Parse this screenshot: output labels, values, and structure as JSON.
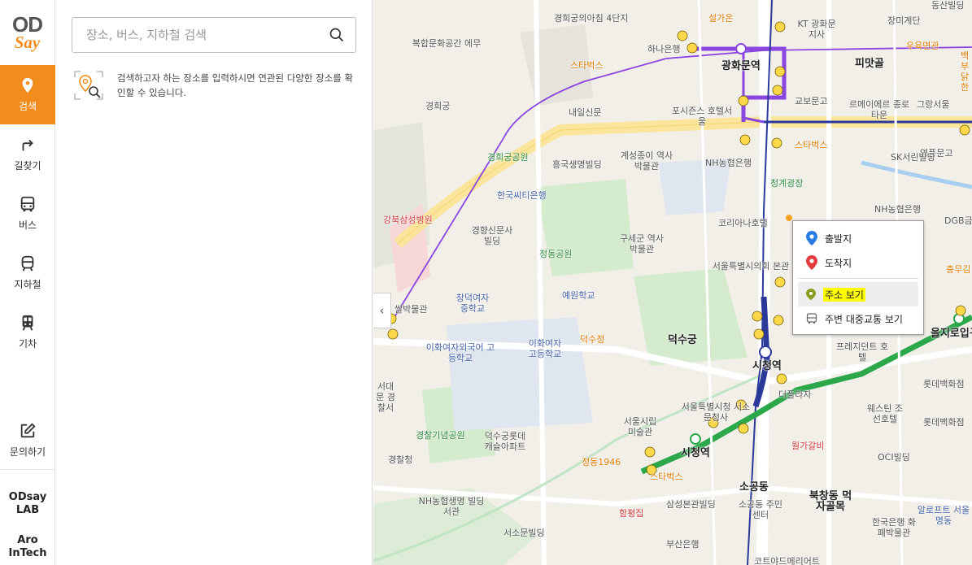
{
  "logo": {
    "top": "OD",
    "bottom": "Say"
  },
  "nav": {
    "items": [
      {
        "label": "검색"
      },
      {
        "label": "길찾기"
      },
      {
        "label": "버스"
      },
      {
        "label": "지하철"
      },
      {
        "label": "기차"
      }
    ],
    "inquiry": "문의하기",
    "lab_line1": "ODsay",
    "lab_line2": "LAB",
    "aro_line1": "Aro",
    "aro_line2": "InTech"
  },
  "search": {
    "placeholder": "장소, 버스, 지하철 검색",
    "hint": "검색하고자 하는 장소를 입력하시면 연관된 다양한 장소를 확인할 수 있습니다."
  },
  "context_menu": {
    "items": [
      "출발지",
      "도착지",
      "주소 보기",
      "주변 대중교통 보기"
    ],
    "highlighted": "주소 보기"
  },
  "map": {
    "labels": [
      "경희궁의아침 4단지",
      "설가온",
      "KT 광화문지사",
      "장미계단",
      "동산빌딩",
      "복합문화공간 에무",
      "하나은행",
      "광화문역",
      "피맛골",
      "우육면관",
      "백부 닭한",
      "스타벅스",
      "교보문고",
      "르메이에르 종로타운",
      "그랑서울",
      "경희궁",
      "내일신문",
      "포시즌스 호텔서울",
      "영풍문고",
      "계성종이 역사박물관",
      "스타벅스",
      "SK서린빌딩",
      "경희궁공원",
      "흥국생명빌딩",
      "NH농협은행",
      "청계광장",
      "한국씨티은행",
      "NH농협은행",
      "DGB금융",
      "강북삼성병원",
      "경향신문사 빌딩",
      "구세군 역사박물관",
      "코리아나호텔",
      "정동공원",
      "서울특별시의회 본관",
      "충무김",
      "쌀박물관",
      "창덕여자 중학교",
      "예원학교",
      "덕수궁",
      "을지로입구",
      "이화여자외국어 고등학교",
      "이화여자 고등학교",
      "덕수정",
      "프레지던트 호텔",
      "시청역",
      "롯데백화점",
      "서대문 경찰서",
      "서울특별시청 서소문청사",
      "더플라자",
      "서울시립 미술관",
      "웨스틴 조선호텔",
      "롯데백화점",
      "경찰기념공원",
      "덕수궁롯데 캐슬아파트",
      "월가갈비",
      "경찰청",
      "정동1946",
      "시청역",
      "OCI빌딩",
      "스타벅스",
      "소공동",
      "NH농협생명 빌딩서관",
      "삼성본관빌딩",
      "북창동 먹자골목",
      "함평집",
      "소공동 주민센터",
      "알로프트 서울명동",
      "서소문빌딩",
      "부산은행",
      "한국은행 화폐박물관",
      "코트야드메리어트"
    ]
  }
}
